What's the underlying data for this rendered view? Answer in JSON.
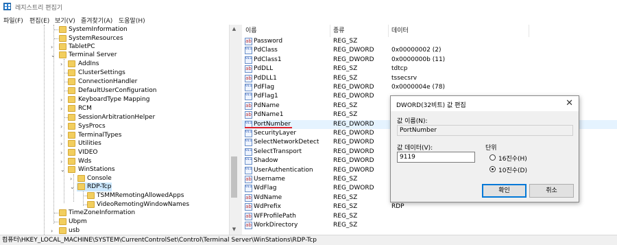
{
  "window": {
    "title": "레지스트리 편집기"
  },
  "menu": [
    "파일(F)",
    "편집(E)",
    "보기(V)",
    "즐겨찾기(A)",
    "도움말(H)"
  ],
  "tree": {
    "items": [
      "SystemInformation",
      "SystemResources",
      "TabletPC",
      "Terminal Server",
      "AddIns",
      "ClusterSettings",
      "ConnectionHandler",
      "DefaultUserConfiguration",
      "KeyboardType Mapping",
      "RCM",
      "SessionArbitrationHelper",
      "SysProcs",
      "TerminalTypes",
      "Utilities",
      "VIDEO",
      "Wds",
      "WinStations",
      "Console",
      "RDP-Tcp",
      "TSMMRemotingAllowedApps",
      "VideoRemotingWindowNames",
      "TimeZoneInformation",
      "Ubpm",
      "usb"
    ]
  },
  "columns": {
    "name": "이름",
    "type": "종류",
    "data": "데이터"
  },
  "values": [
    {
      "icon": "string-value-icon",
      "name": "Password",
      "type": "REG_SZ",
      "data": ""
    },
    {
      "icon": "dword-value-icon",
      "name": "PdClass",
      "type": "REG_DWORD",
      "data": "0x00000002 (2)"
    },
    {
      "icon": "dword-value-icon",
      "name": "PdClass1",
      "type": "REG_DWORD",
      "data": "0x0000000b (11)"
    },
    {
      "icon": "string-value-icon",
      "name": "PdDLL",
      "type": "REG_SZ",
      "data": "tdtcp"
    },
    {
      "icon": "string-value-icon",
      "name": "PdDLL1",
      "type": "REG_SZ",
      "data": "tssecsrv"
    },
    {
      "icon": "dword-value-icon",
      "name": "PdFlag",
      "type": "REG_DWORD",
      "data": "0x0000004e (78)"
    },
    {
      "icon": "dword-value-icon",
      "name": "PdFlag1",
      "type": "REG_DWORD",
      "data": ""
    },
    {
      "icon": "string-value-icon",
      "name": "PdName",
      "type": "REG_SZ",
      "data": ""
    },
    {
      "icon": "string-value-icon",
      "name": "PdName1",
      "type": "REG_SZ",
      "data": ""
    },
    {
      "icon": "dword-value-icon",
      "name": "PortNumber",
      "type": "REG_DWORD",
      "data": ""
    },
    {
      "icon": "dword-value-icon",
      "name": "SecurityLayer",
      "type": "REG_DWORD",
      "data": ""
    },
    {
      "icon": "dword-value-icon",
      "name": "SelectNetworkDetect",
      "type": "REG_DWORD",
      "data": ""
    },
    {
      "icon": "dword-value-icon",
      "name": "SelectTransport",
      "type": "REG_DWORD",
      "data": ""
    },
    {
      "icon": "dword-value-icon",
      "name": "Shadow",
      "type": "REG_DWORD",
      "data": ""
    },
    {
      "icon": "dword-value-icon",
      "name": "UserAuthentication",
      "type": "REG_DWORD",
      "data": ""
    },
    {
      "icon": "string-value-icon",
      "name": "Username",
      "type": "REG_SZ",
      "data": ""
    },
    {
      "icon": "dword-value-icon",
      "name": "WdFlag",
      "type": "REG_DWORD",
      "data": ""
    },
    {
      "icon": "string-value-icon",
      "name": "WdName",
      "type": "REG_SZ",
      "data": ""
    },
    {
      "icon": "string-value-icon",
      "name": "WdPrefix",
      "type": "REG_SZ",
      "data": "RDP"
    },
    {
      "icon": "string-value-icon",
      "name": "WFProfilePath",
      "type": "REG_SZ",
      "data": ""
    },
    {
      "icon": "string-value-icon",
      "name": "WorkDirectory",
      "type": "REG_SZ",
      "data": ""
    }
  ],
  "status": {
    "path": "컴퓨터\\HKEY_LOCAL_MACHINE\\SYSTEM\\CurrentControlSet\\Control\\Terminal Server\\WinStations\\RDP-Tcp"
  },
  "dialog": {
    "title": "DWORD(32비트) 값 편집",
    "name_label": "값 이름(N):",
    "name_value": "PortNumber",
    "data_label": "값 데이터(V):",
    "data_value": "9119",
    "base_label": "단위",
    "hex_label": "16진수(H)",
    "dec_label": "10진수(D)",
    "ok_label": "확인",
    "cancel_label": "취소"
  }
}
